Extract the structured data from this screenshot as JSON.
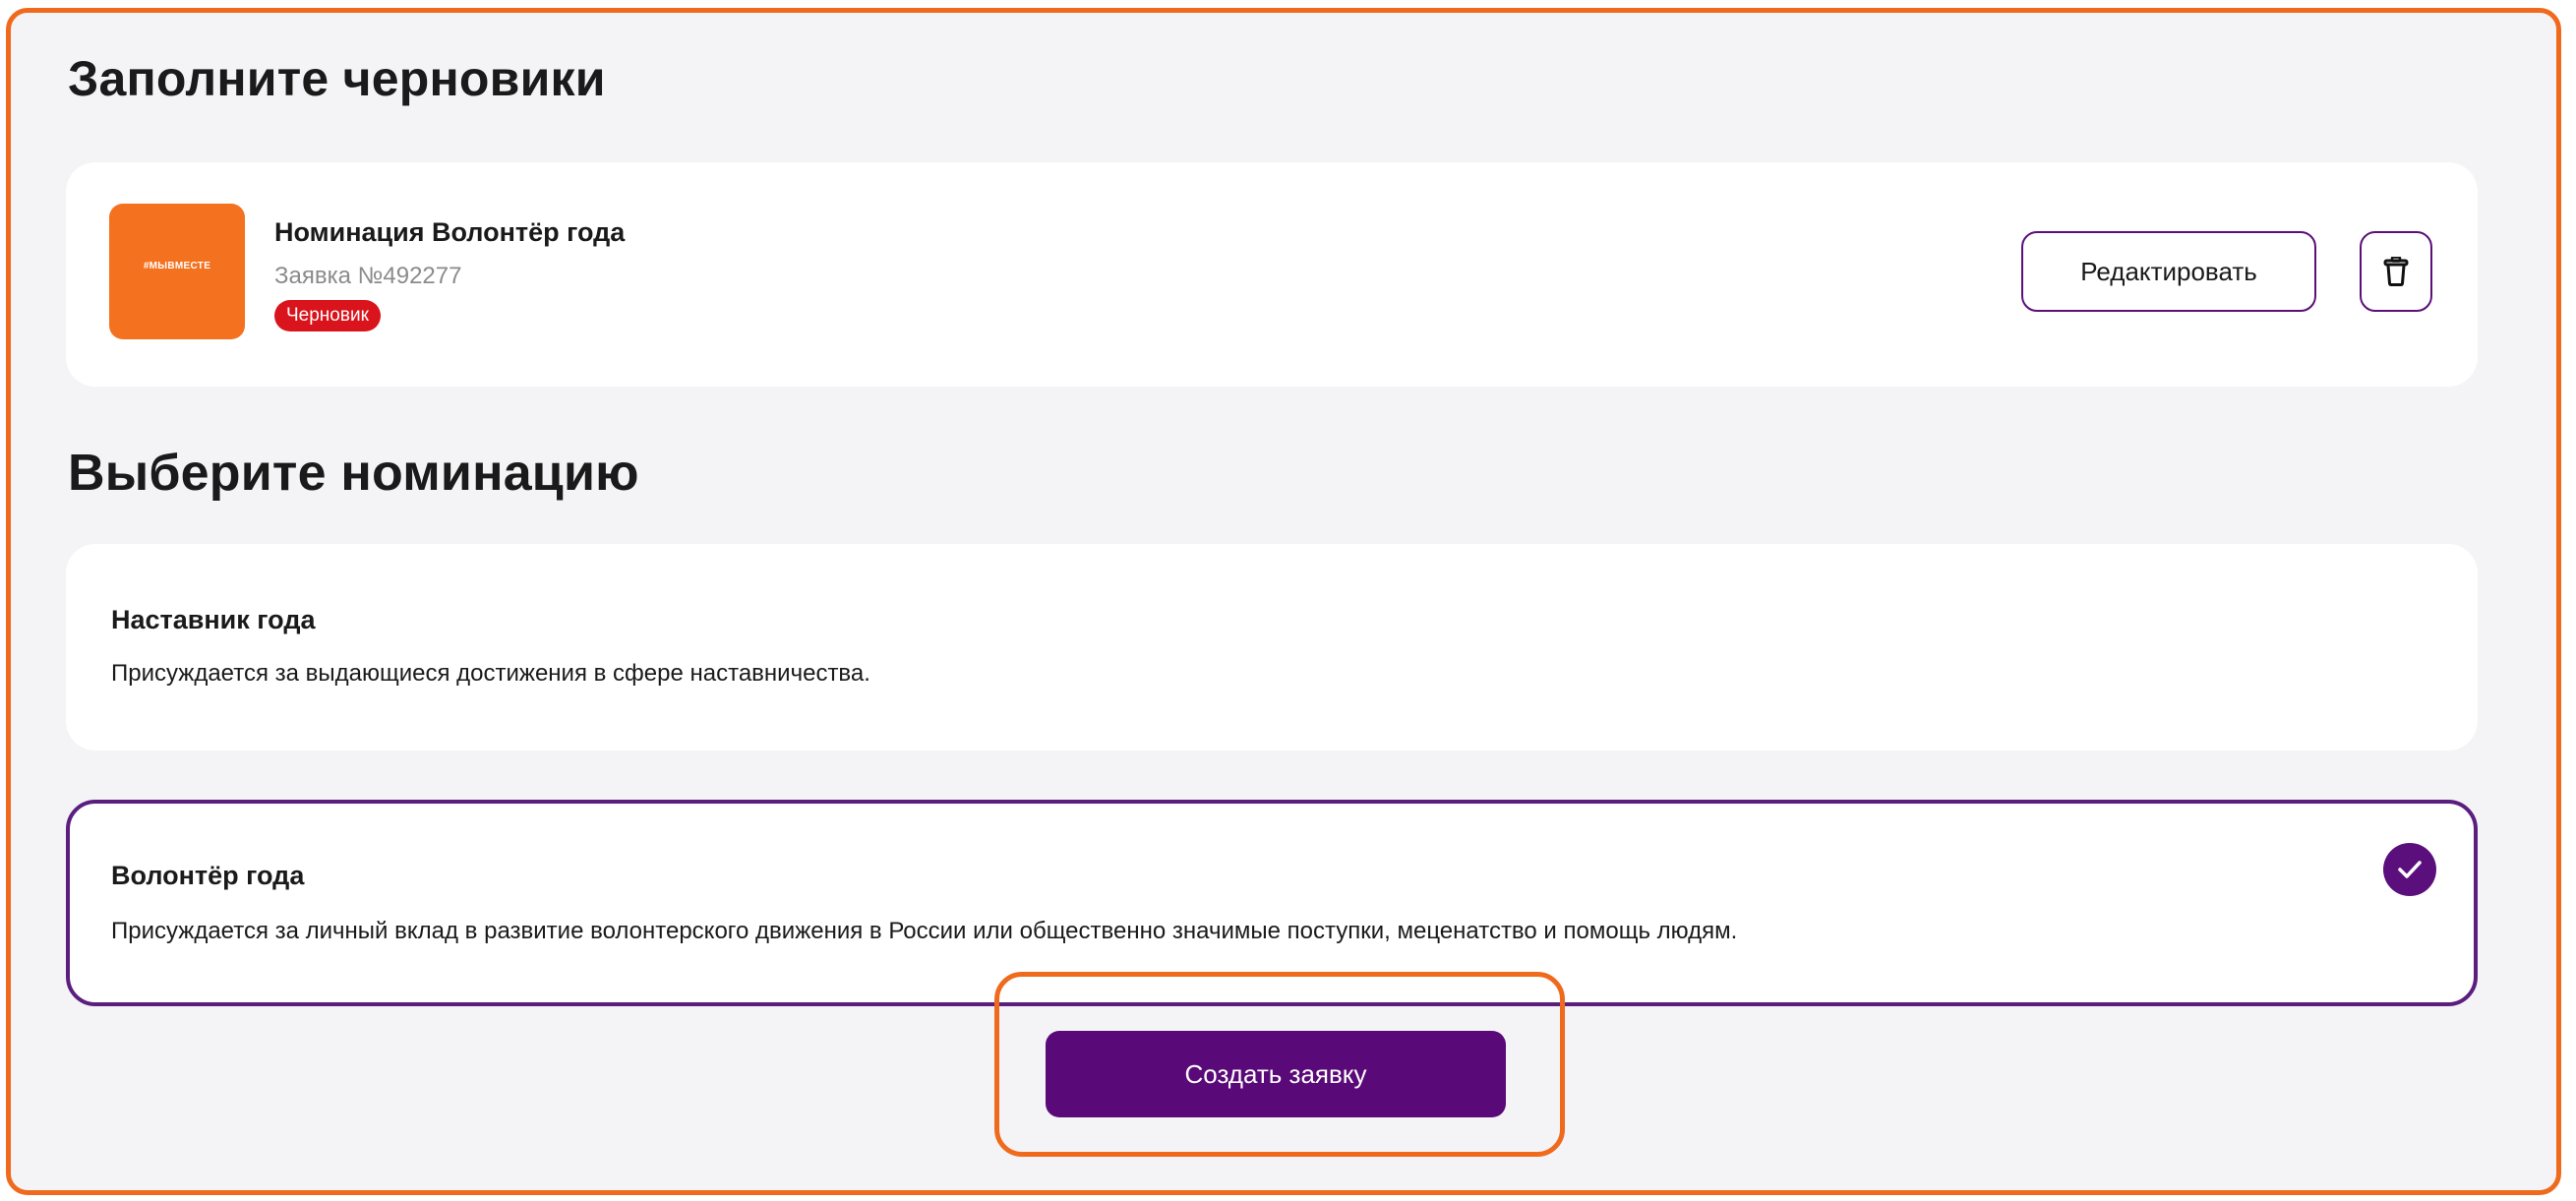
{
  "sections": {
    "drafts_title": "Заполните черновики",
    "choose_title": "Выберите номинацию"
  },
  "draft": {
    "title": "Номинация Волонтёр года",
    "number": "Заявка №492277",
    "badge": "Черновик",
    "logo_text": "#МЫВМЕСТЕ",
    "edit_label": "Редактировать"
  },
  "nominations": [
    {
      "title": "Наставник года",
      "description": "Присуждается за выдающиеся достижения в сфере наставничества.",
      "selected": false
    },
    {
      "title": "Волонтёр года",
      "description": "Присуждается за личный вклад в развитие волонтерского движения в России или общественно значимые поступки, меценатство и помощь людям.",
      "selected": true
    }
  ],
  "actions": {
    "create_label": "Создать заявку"
  },
  "colors": {
    "accent_orange": "#f06a1e",
    "brand_purple": "#5a0a78",
    "badge_red": "#d9141c",
    "logo_orange": "#f4721f"
  },
  "icons": {
    "delete": "trash-icon",
    "selected": "check-icon"
  }
}
